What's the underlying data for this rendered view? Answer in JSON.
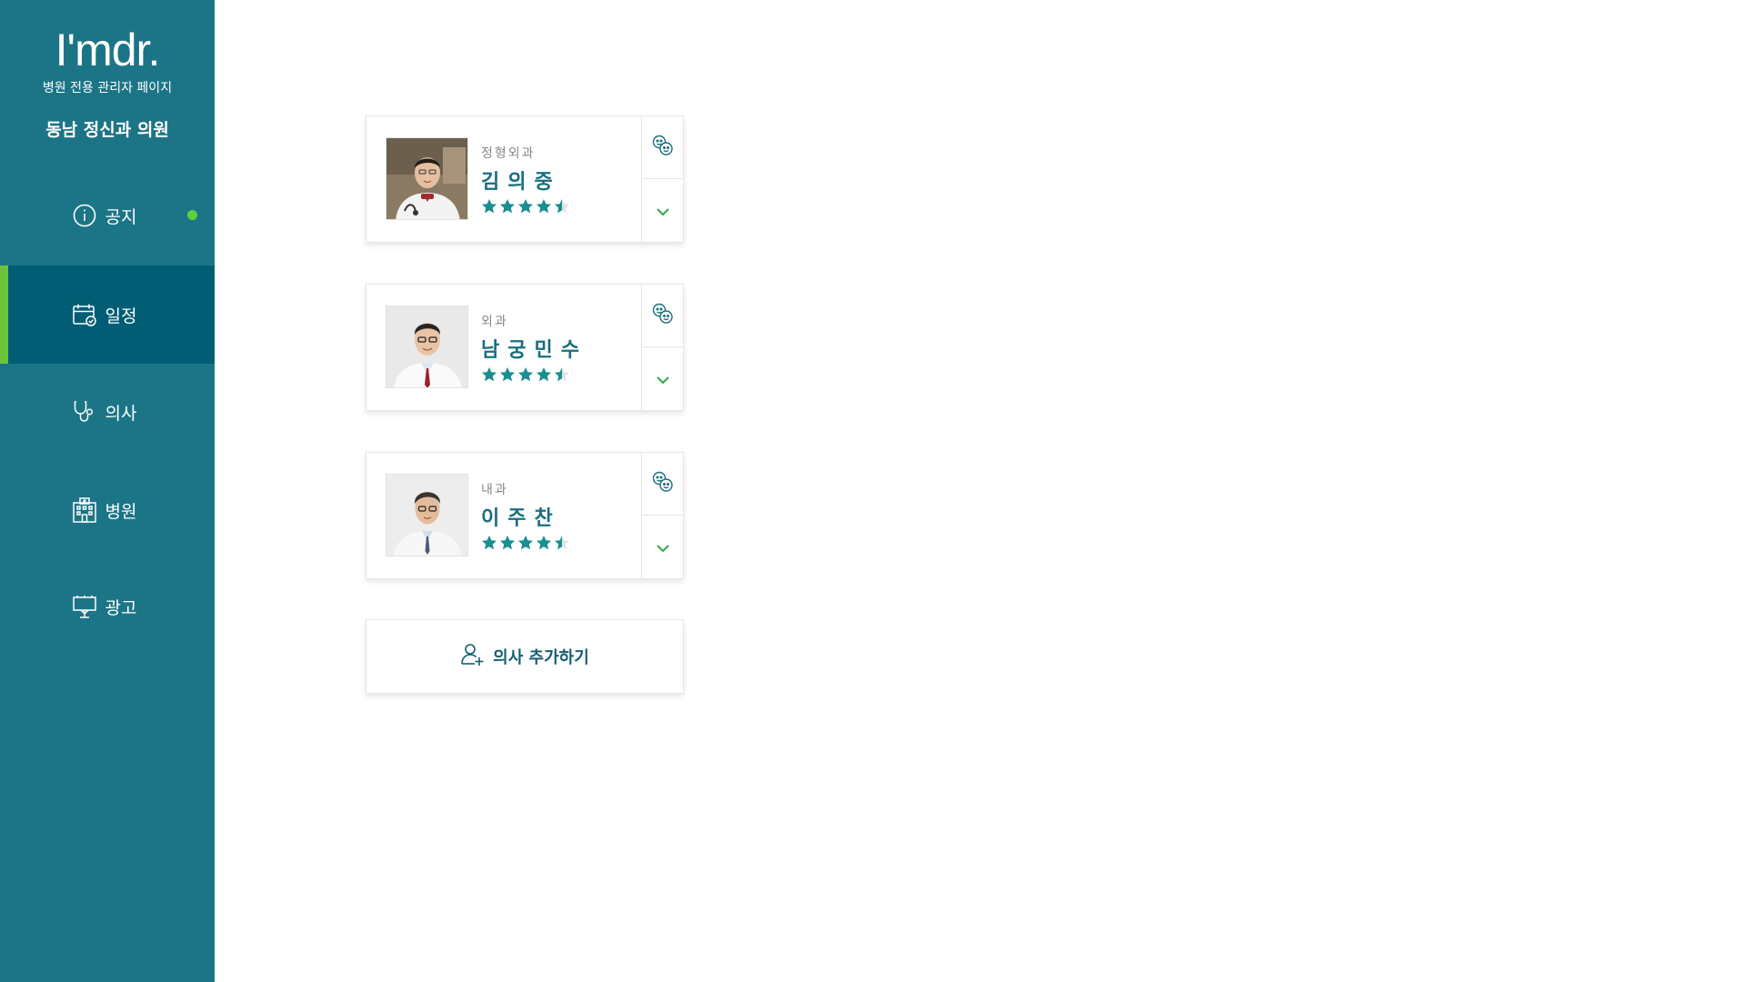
{
  "brand": {
    "logo": "I'mdr.",
    "subtitle": "병원 전용 관리자 페이지",
    "clinic_name": "동남 정신과 의원"
  },
  "nav": [
    {
      "label": "공지",
      "icon": "info-icon",
      "has_dot": true
    },
    {
      "label": "일정",
      "icon": "calendar-icon",
      "active": true
    },
    {
      "label": "의사",
      "icon": "stethoscope-icon"
    },
    {
      "label": "병원",
      "icon": "hospital-icon"
    },
    {
      "label": "광고",
      "icon": "billboard-icon"
    }
  ],
  "doctors": [
    {
      "dept": "정형외과",
      "name": "김의중",
      "rating": 4.5
    },
    {
      "dept": "외과",
      "name": "남궁민수",
      "rating": 4.5
    },
    {
      "dept": "내과",
      "name": "이주찬",
      "rating": 4.5
    }
  ],
  "add_doctor": {
    "label": "의사 추가하기"
  },
  "colors": {
    "sidebar": "#1c7586",
    "active": "#005d74",
    "accent": "#6ec33e",
    "star": "#1a8e92",
    "name": "#1a6e7f"
  }
}
